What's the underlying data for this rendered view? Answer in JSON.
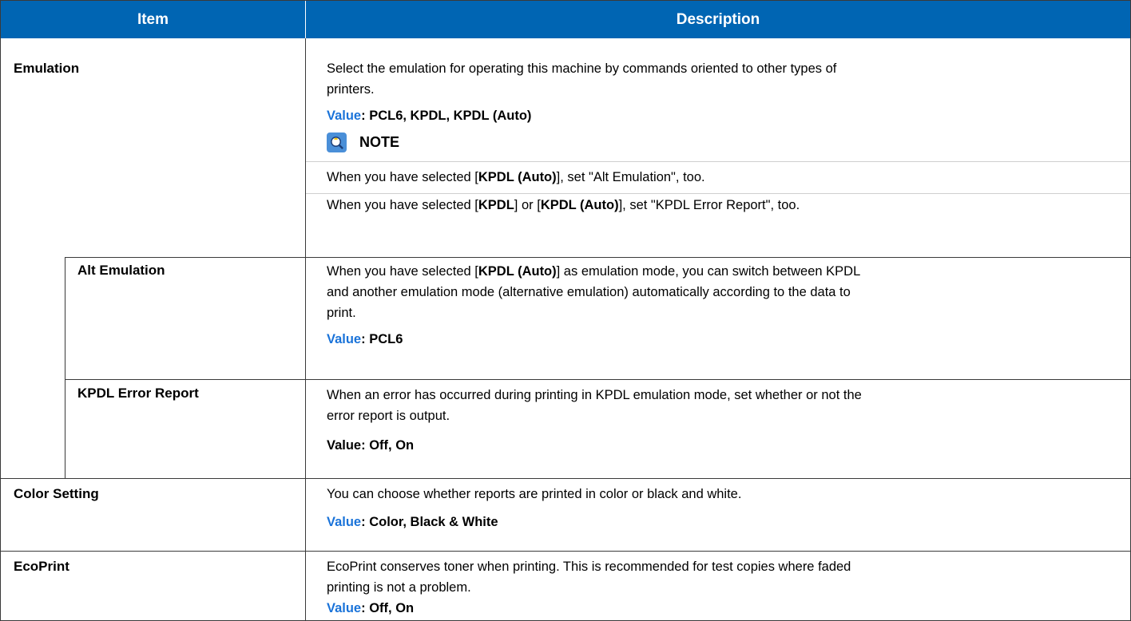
{
  "header": {
    "item": "Item",
    "description": "Description"
  },
  "rows": {
    "emulation": {
      "label": "Emulation",
      "desc_line1": "Select the emulation for operating this machine by commands oriented to other types of",
      "desc_line2": "printers.",
      "value_label": "Value",
      "value_text": ": PCL6, KPDL, KPDL (Auto)",
      "note_title": "NOTE",
      "note1_a": "When you have selected [",
      "note1_b": "KPDL (Auto)",
      "note1_c": "], set \"Alt Emulation\", too.",
      "note2_a": "When you have selected [",
      "note2_b": "KPDL",
      "note2_c": "] or [",
      "note2_d": "KPDL (Auto)",
      "note2_e": "], set \"KPDL Error Report\", too."
    },
    "alt_emulation": {
      "label": "Alt Emulation",
      "desc1_a": "When you have selected [",
      "desc1_b": "KPDL (Auto)",
      "desc1_c": "] as emulation mode, you can switch between KPDL",
      "desc2": "and another emulation mode (alternative emulation) automatically according to the data to",
      "desc3": "print.",
      "value_label": "Value",
      "value_text": ": PCL6"
    },
    "kpdl_error_report": {
      "label": "KPDL Error Report",
      "desc1": "When an error has occurred during printing in KPDL emulation mode, set whether or not the",
      "desc2": "error report is output.",
      "value_label": "Value",
      "value_text": ": Off, On"
    },
    "color_setting": {
      "label": "Color Setting",
      "desc1": "You can choose whether reports are printed in color or black and white.",
      "value_label": "Value",
      "value_text": ": Color, Black & White"
    },
    "ecoprint": {
      "label": "EcoPrint",
      "desc1": "EcoPrint conserves toner when printing. This is recommended for test copies where faded",
      "desc2": "printing is not a problem.",
      "value_label": "Value",
      "value_text": ": Off, On"
    }
  },
  "colors": {
    "header_bg": "#0065b3",
    "value_label": "#1a73d9",
    "note_icon": "#4a8fd8"
  }
}
